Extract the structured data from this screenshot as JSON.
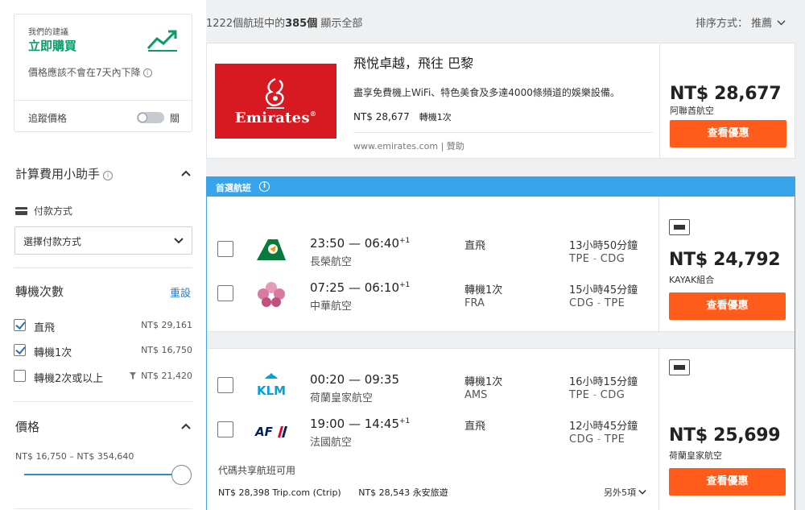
{
  "sidebar": {
    "advice": {
      "small": "我們的建議",
      "headline": "立即購買",
      "note": "價格應該不會在7天內下降",
      "track_label": "追蹤價格",
      "toggle_state": "關",
      "accent": "#0c9a6b"
    },
    "fee_helper": {
      "title": "計算費用小助手",
      "payment_label": "付款方式",
      "payment_select": "選擇付款方式"
    },
    "stops": {
      "title": "轉機次數",
      "reset": "重設",
      "options": [
        {
          "label": "直飛",
          "price": "NT$ 29,161",
          "checked": true
        },
        {
          "label": "轉機1次",
          "price": "NT$ 16,750",
          "checked": true
        },
        {
          "label": "轉機2次或以上",
          "price": "NT$ 21,420",
          "checked": false
        }
      ]
    },
    "price_filter": {
      "title": "價格",
      "range": "NT$ 16,750 – NT$ 354,640",
      "slider_position": 1.0
    }
  },
  "results": {
    "count_prefix": "1222個航班中的",
    "count_shown": "385個",
    "show_all": " 顯示全部",
    "sort_label": "排序方式：",
    "sort_value": "推薦"
  },
  "ad": {
    "logo_text": "Emirates",
    "logo_color": "#d71921",
    "title": "飛悅卓越，飛往 巴黎",
    "desc": "盡享免費機上WiFi、特色美食及多達4000條頻道的娛樂設備。",
    "price": "NT$ 28,677",
    "stops": "轉機1次",
    "source": "www.emirates.com | 贊助",
    "big_price": "NT$ 28,677",
    "provider": "阿聯酋航空",
    "button": "查看優惠"
  },
  "best": {
    "banner": "首選航班",
    "cards": [
      {
        "legs": [
          {
            "logo": "eva-air-logo",
            "times": "23:50 — 06:40",
            "plus": "+1",
            "airline": "長榮航空",
            "stops": "直飛",
            "via": "",
            "duration": "13小時50分鐘",
            "from": "TPE",
            "to": "CDG"
          },
          {
            "logo": "china-airlines-logo",
            "times": "07:25 — 06:10",
            "plus": "+1",
            "airline": "中華航空",
            "stops": "轉機1次",
            "via": "FRA",
            "duration": "15小時45分鐘",
            "from": "CDG",
            "to": "TPE"
          }
        ],
        "price": "NT$ 24,792",
        "provider": "KAYAK組合",
        "button": "查看優惠"
      },
      {
        "legs": [
          {
            "logo": "klm-logo",
            "times": "00:20 — 09:35",
            "plus": "",
            "airline": "荷蘭皇家航空",
            "stops": "轉機1次",
            "via": "AMS",
            "duration": "16小時15分鐘",
            "from": "TPE",
            "to": "CDG"
          },
          {
            "logo": "air-france-logo",
            "times": "19:00 — 14:45",
            "plus": "+1",
            "airline": "法國航空",
            "stops": "直飛",
            "via": "",
            "duration": "12小時45分鐘",
            "from": "CDG",
            "to": "TPE"
          }
        ],
        "codeshare": "代碼共享航班可用",
        "alt_prices": [
          "NT$ 28,398 Trip.com (Ctrip)",
          "NT$ 28,543 永安旅遊"
        ],
        "more": "另外5項",
        "price": "NT$ 25,699",
        "provider": "荷蘭皇家航空",
        "button": "查看優惠"
      }
    ]
  },
  "colors": {
    "deal_button": "#ff5b1a",
    "link": "#1b7fd4",
    "banner": "#38a4ec"
  }
}
